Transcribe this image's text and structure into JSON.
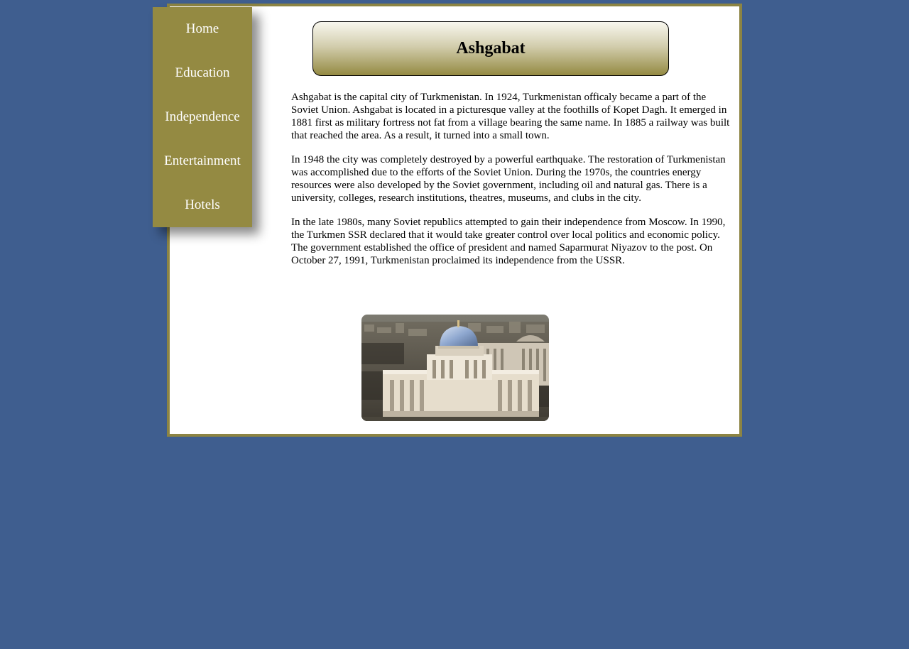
{
  "nav": {
    "items": [
      {
        "label": "Home"
      },
      {
        "label": "Education"
      },
      {
        "label": "Independence"
      },
      {
        "label": "Entertainment"
      },
      {
        "label": "Hotels"
      }
    ]
  },
  "header": {
    "title": "Ashgabat"
  },
  "main": {
    "paragraphs": [
      "Ashgabat is the capital city of Turkmenistan. In 1924, Turkmenistan officaly became a part of the Soviet Union. Ashgabat is located in a picturesque valley at the foothills of Kopet Dagh. It emerged in 1881 first as military fortress not fat from a village bearing the same name. In 1885 a railway was built that reached the area. As a result, it turned into a small town.",
      "In 1948 the city was completely destroyed by a powerful earthquake. The restoration of Turkmenistan was accomplished due to the efforts of the Soviet Union. During the 1970s, the countries energy resources were also developed by the Soviet government, including oil and natural gas. There is a university, colleges, research institutions, theatres, museums, and clubs in the city.",
      "In the late 1980s, many Soviet republics attempted to gain their independence from Moscow. In 1990, the Turkmen SSR declared that it would take greater control over local politics and economic policy. The government established the office of president and named Saparmurat Niyazov to the post. On October 27, 1991, Turkmenistan proclaimed its independence from the USSR."
    ]
  },
  "colors": {
    "page_background": "#3f5e8f",
    "accent_olive": "#948a42",
    "frame_border": "#8c8443",
    "content_background": "#ffffff"
  }
}
